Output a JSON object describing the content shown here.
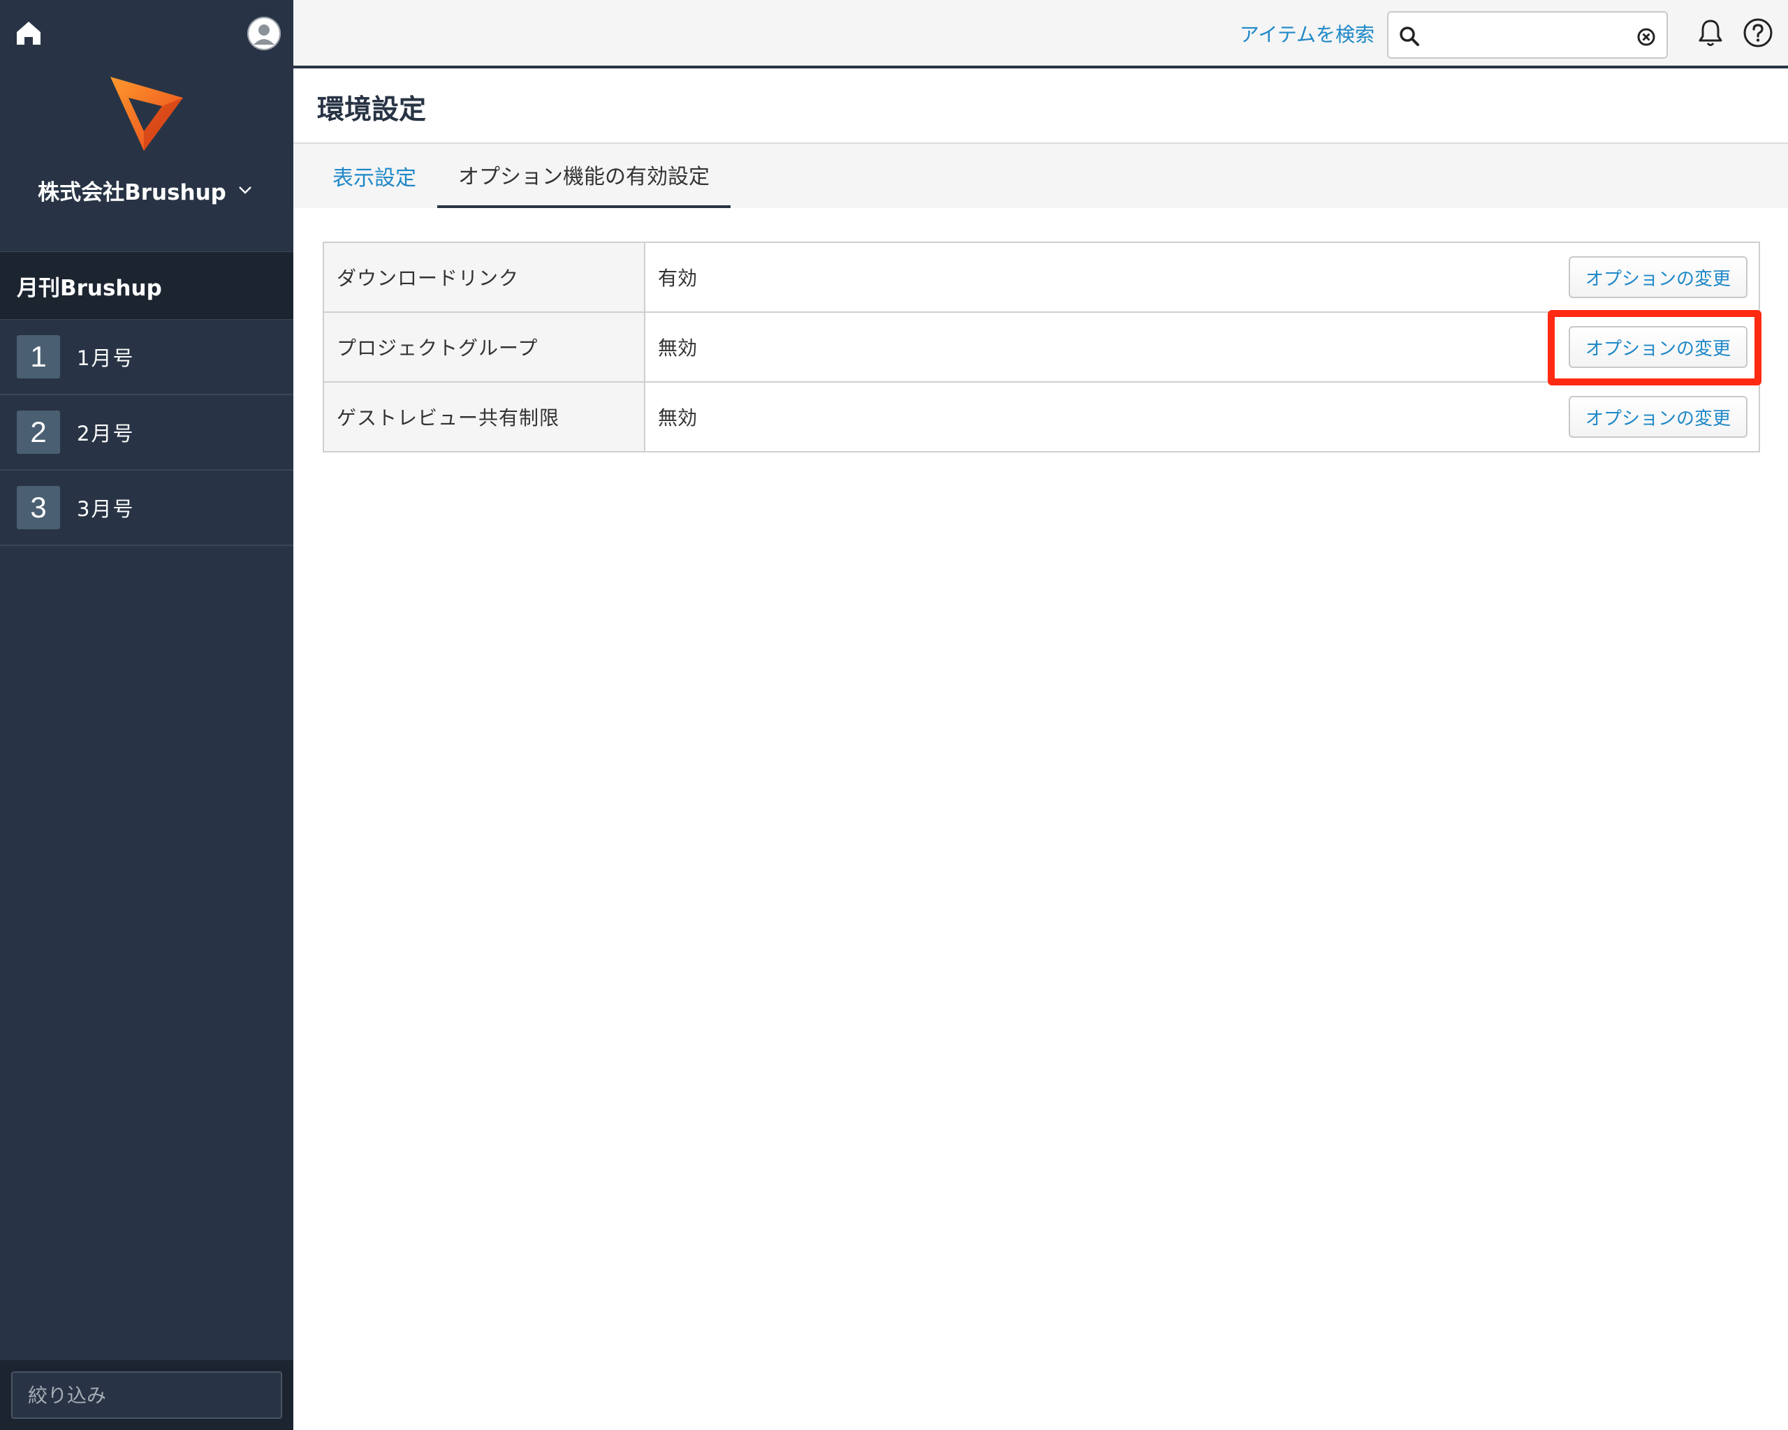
{
  "sidebar": {
    "company_name": "株式会社Brushup",
    "section_title": "月刊Brushup",
    "items": [
      {
        "number": "1",
        "label": "1月号"
      },
      {
        "number": "2",
        "label": "2月号"
      },
      {
        "number": "3",
        "label": "3月号"
      }
    ],
    "filter_placeholder": "絞り込み"
  },
  "header": {
    "search_link": "アイテムを検索",
    "search_value": ""
  },
  "page": {
    "title": "環境設定",
    "tabs": [
      {
        "label": "表示設定",
        "active": false
      },
      {
        "label": "オプション機能の有効設定",
        "active": true
      }
    ]
  },
  "options_table": {
    "rows": [
      {
        "name": "ダウンロードリンク",
        "status": "有効",
        "button": "オプションの変更"
      },
      {
        "name": "プロジェクトグループ",
        "status": "無効",
        "button": "オプションの変更",
        "highlighted": true
      },
      {
        "name": "ゲストレビュー共有制限",
        "status": "無効",
        "button": "オプションの変更"
      }
    ]
  },
  "colors": {
    "sidebar_bg": "#283445",
    "accent": "#1e88c8",
    "highlight": "#ff2a12",
    "logo_orange": "#f26b1d"
  },
  "icons": [
    "home-icon",
    "avatar-icon",
    "brushup-logo",
    "chevron-down-icon",
    "search-icon",
    "clear-icon",
    "bell-icon",
    "help-icon"
  ]
}
